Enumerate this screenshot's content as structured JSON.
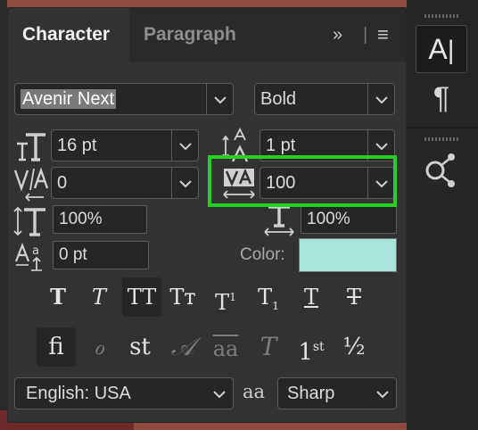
{
  "tabs": {
    "character": "Character",
    "paragraph": "Paragraph",
    "more": "»",
    "menu": "≡"
  },
  "font": {
    "family": "Avenir Next",
    "style": "Bold"
  },
  "size": {
    "font_size": "16 pt",
    "leading": "1 pt"
  },
  "kerning": {
    "value": "0"
  },
  "tracking": {
    "value": "100"
  },
  "scale": {
    "vertical": "100%",
    "horizontal": "100%"
  },
  "baseline": {
    "value": "0 pt"
  },
  "color": {
    "label": "Color:",
    "swatch": "#a8e6dc"
  },
  "style_buttons": {
    "faux_bold": "T",
    "faux_italic": "T",
    "all_caps": "TT",
    "small_caps": "Tт",
    "superscript": "T",
    "superscript_mark": "1",
    "subscript": "T",
    "subscript_mark": "1",
    "underline": "T",
    "strikethrough": "T"
  },
  "opentype_buttons": {
    "ligatures": "fi",
    "discretionary": "ℴ",
    "contextual": "st",
    "swash": "𝒜",
    "stylistic": "aa",
    "titling": "T",
    "ordinals_base": "1",
    "ordinals_mark": "st",
    "fractions": "½"
  },
  "language": {
    "value": "English: USA",
    "aa_icon": "aa",
    "antialias": "Sharp"
  },
  "toolstrip": {
    "character_icon": "A",
    "paragraph_icon": "¶"
  },
  "colors": {
    "highlight": "#1ed41e",
    "panel": "#323232"
  }
}
